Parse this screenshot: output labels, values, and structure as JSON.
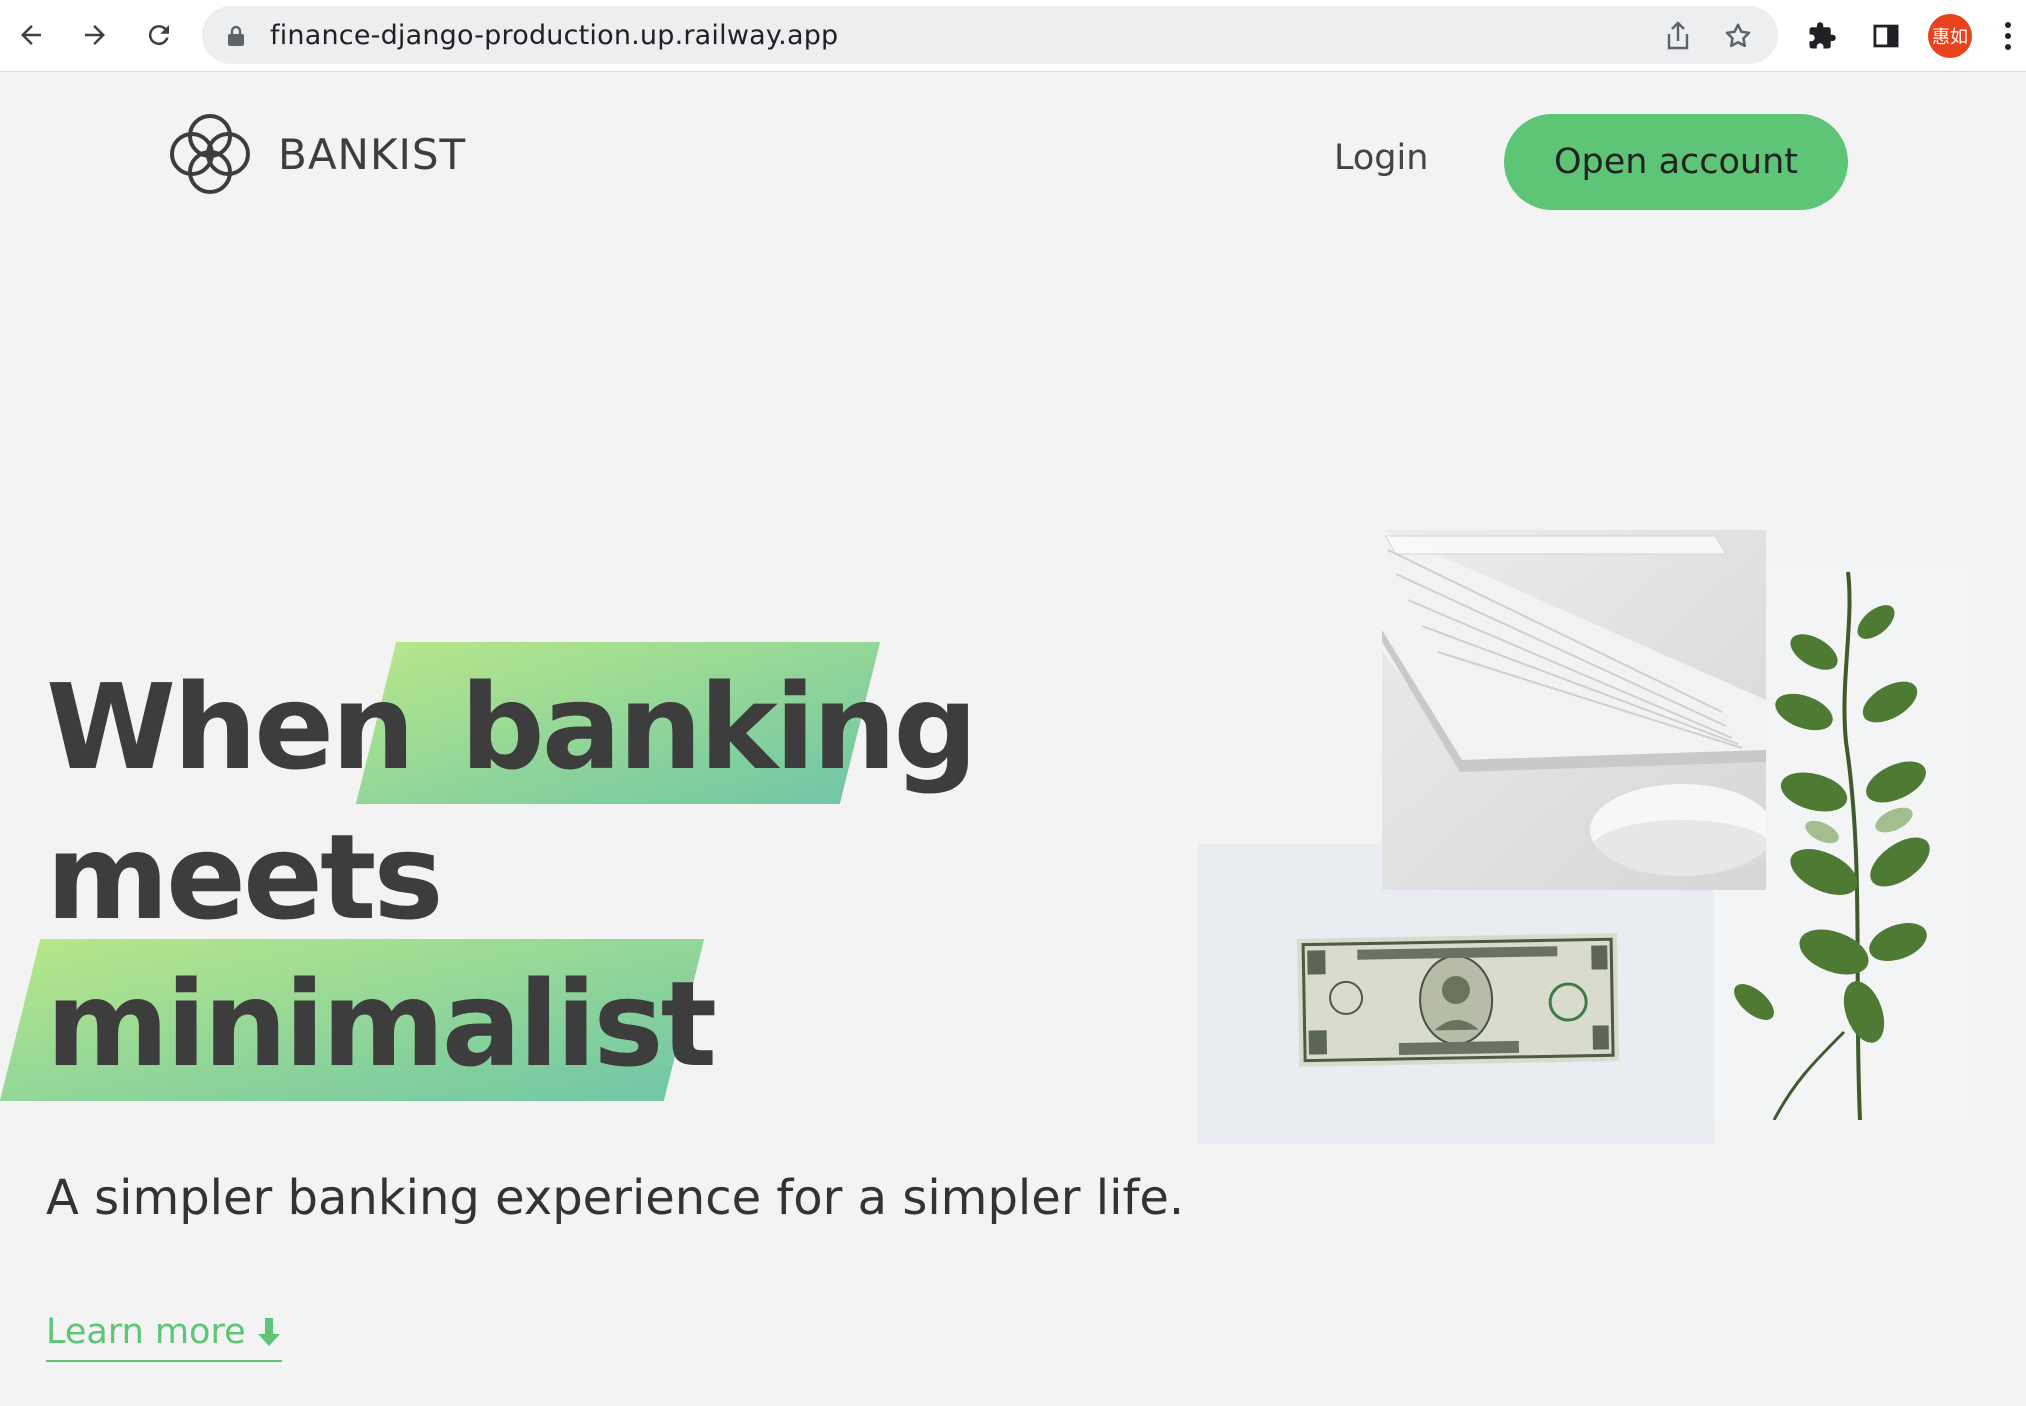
{
  "browser": {
    "url": "finance-django-production.up.railway.app",
    "profile_initials": "惠如",
    "icons": [
      "back-icon",
      "forward-icon",
      "reload-icon",
      "lock-icon",
      "share-icon",
      "bookmark-star-icon",
      "extensions-icon",
      "side-panel-icon",
      "menu-dots-icon"
    ]
  },
  "site": {
    "brand": "BANKIST",
    "nav": {
      "login": "Login",
      "open_account": "Open account"
    },
    "hero": {
      "line1_plain": "When",
      "line1_highlight": "banking",
      "line2": "meets",
      "line3_highlight": "minimalist",
      "subtitle": "A simpler banking experience for a simpler life.",
      "learn_more": "Learn more"
    },
    "colors": {
      "primary": "#5ec576",
      "gradient_start": "#9be15d",
      "gradient_end": "#39b385",
      "text": "#444444",
      "background": "#f3f3f3"
    }
  }
}
